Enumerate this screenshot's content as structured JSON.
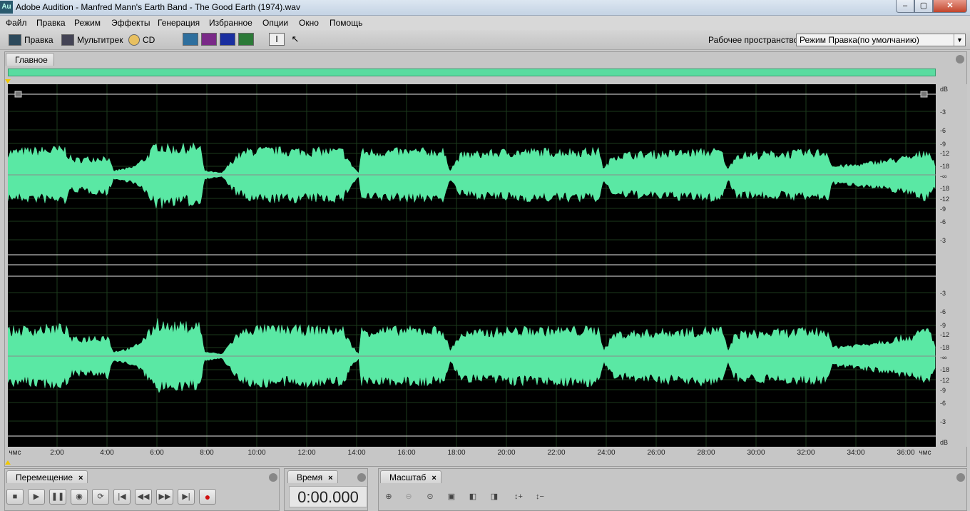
{
  "window": {
    "app_icon": "Au",
    "title": "Adobe Audition - Manfred Mann's Earth Band - The Good Earth (1974).wav",
    "minimize": "–",
    "maximize": "▢",
    "close": "✕"
  },
  "menu": [
    "Файл",
    "Правка",
    "Режим",
    "Эффекты",
    "Генерация",
    "Избранное",
    "Опции",
    "Окно",
    "Помощь"
  ],
  "toolbar": {
    "edit_label": "Правка",
    "multitrack_label": "Мультитрек",
    "cd_label": "CD",
    "workspace_label": "Рабочее пространство:",
    "workspace_value": "Режим Правка(по умолчанию)"
  },
  "main_panel": {
    "tab_label": "Главное",
    "waveform_color": "#5ae8a4",
    "db_labels_top": [
      "dB",
      "-3",
      "-6",
      "-9",
      "-12",
      "-18",
      "-∞",
      "-18",
      "-12",
      "-9",
      "-6",
      "-3"
    ],
    "db_labels_bottom": [
      "-3",
      "-6",
      "-9",
      "-12",
      "-18",
      "-∞",
      "-18",
      "-12",
      "-9",
      "-6",
      "-3",
      "dB"
    ],
    "time_labels": [
      "чмс",
      "2:00",
      "4:00",
      "6:00",
      "8:00",
      "10:00",
      "12:00",
      "14:00",
      "16:00",
      "18:00",
      "20:00",
      "22:00",
      "24:00",
      "26:00",
      "28:00",
      "30:00",
      "32:00",
      "34:00",
      "36:00",
      "чмс"
    ]
  },
  "transport": {
    "tab_label": "Перемещение",
    "tab_close": "×"
  },
  "time_panel": {
    "tab_label": "Время",
    "tab_close": "×",
    "value": "0:00.000"
  },
  "zoom_panel": {
    "tab_label": "Масштаб",
    "tab_close": "×"
  }
}
